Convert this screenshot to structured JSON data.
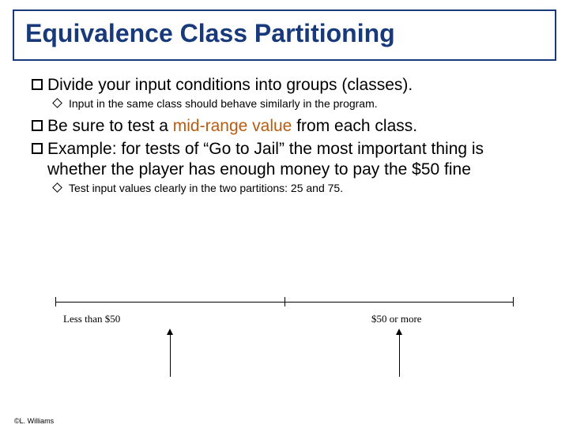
{
  "title": "Equivalence Class Partitioning",
  "bullets": [
    {
      "level": 1,
      "text": "Divide your input conditions into groups (classes)."
    },
    {
      "level": 2,
      "text": "Input in the same class should behave similarly in the program."
    },
    {
      "level": 1,
      "pre": "Be sure to test a ",
      "highlight": "mid-range value",
      "post": " from each class."
    },
    {
      "level": 1,
      "text": "Example: for tests of “Go to Jail” the most important thing is whether the player has enough money to pay the $50 fine"
    },
    {
      "level": 2,
      "text": "Test input values clearly in the two partitions: 25 and 75."
    }
  ],
  "diagram": {
    "label_left": "Less than $50",
    "label_right": "$50 or more"
  },
  "footer": "©L. Williams"
}
